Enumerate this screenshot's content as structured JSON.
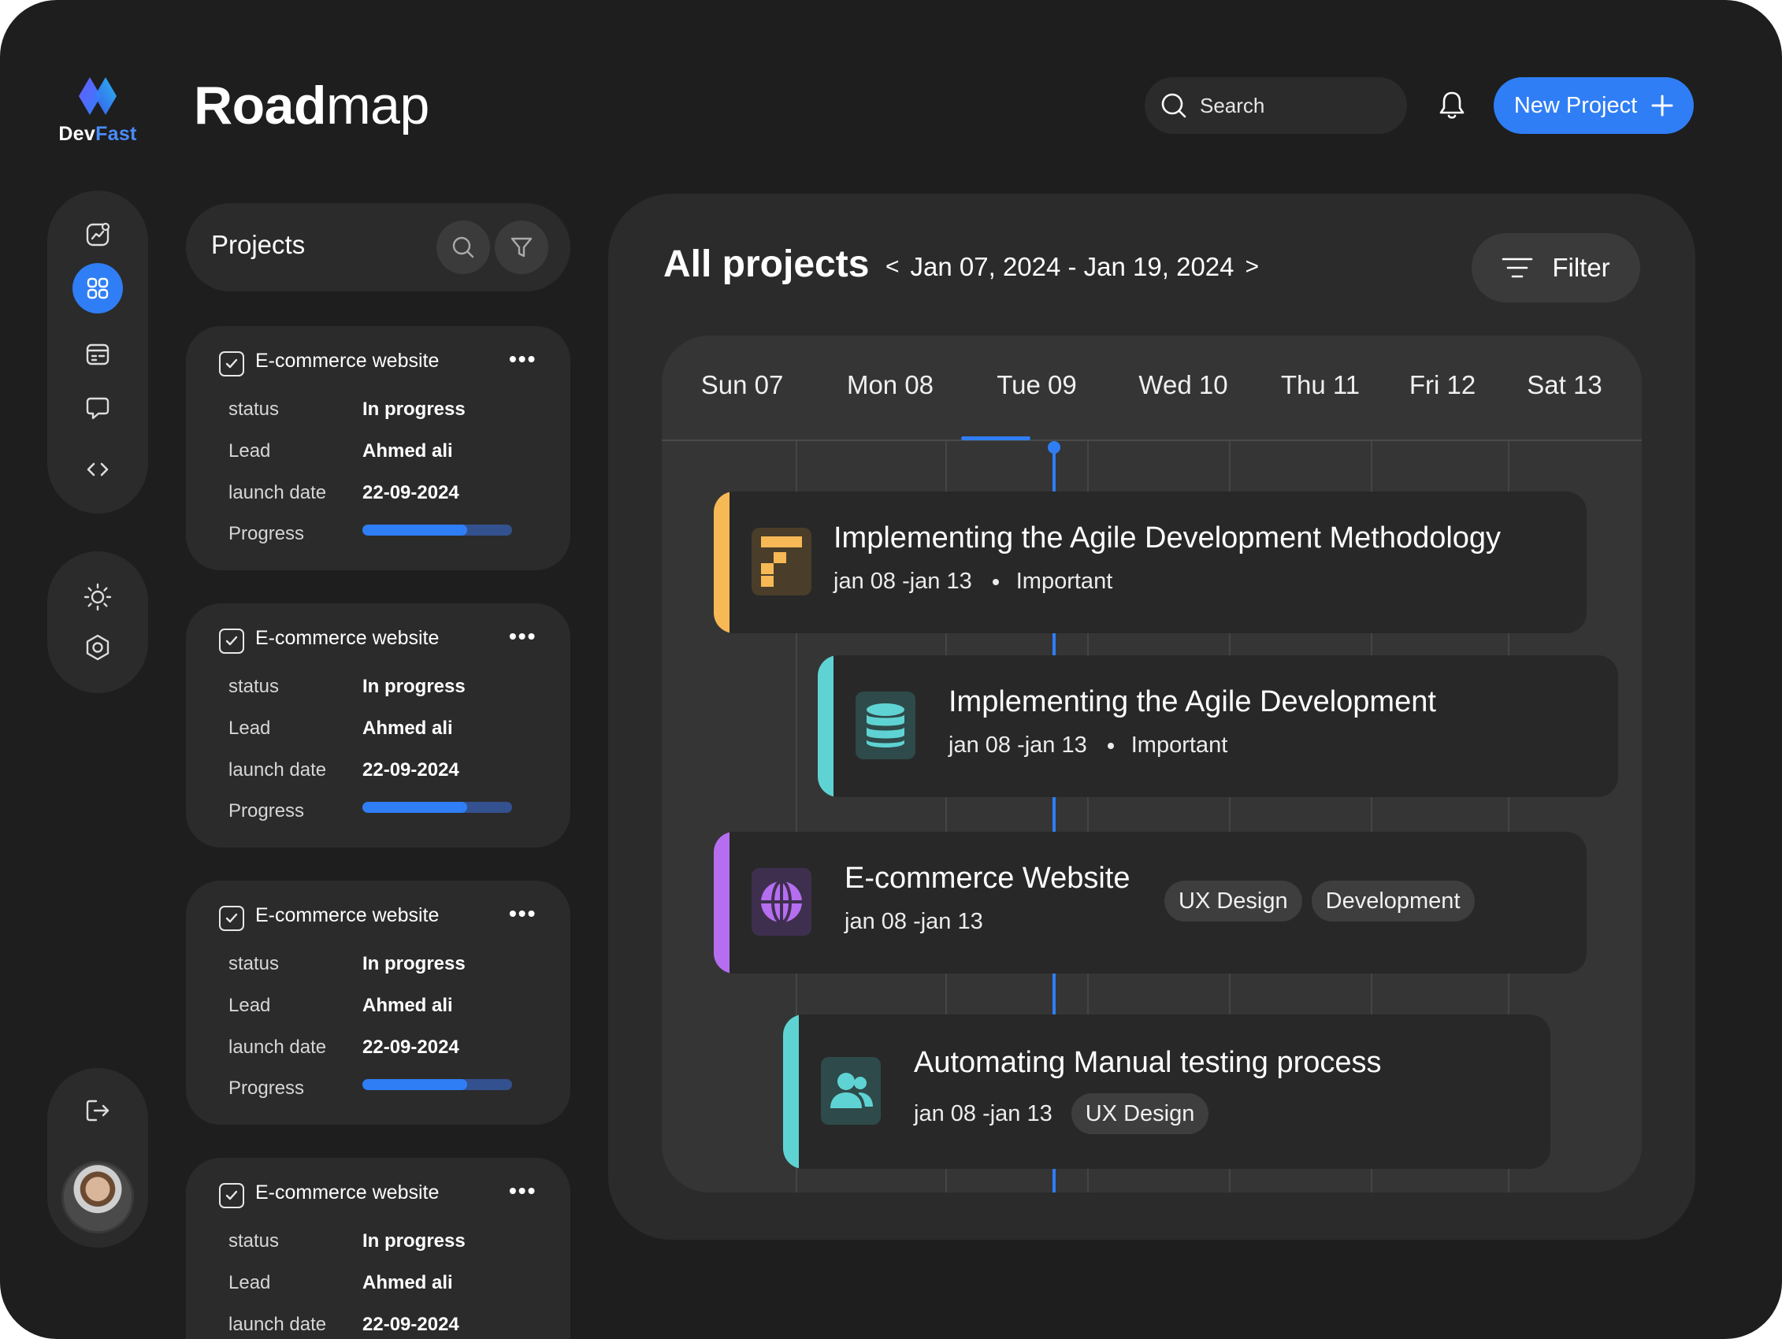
{
  "brand": {
    "name_a": "Dev",
    "name_b": "Fast",
    "accent": "#2f7ef5"
  },
  "page_title": {
    "bold": "Road",
    "regular": "map"
  },
  "header": {
    "search_placeholder": "Search",
    "new_project_label": "New Project"
  },
  "rail": {
    "items": [
      "analytics-icon",
      "grid-icon",
      "layout-icon",
      "chat-icon",
      "code-icon"
    ],
    "active": "grid-icon",
    "settings": [
      "sun-icon",
      "settings-icon"
    ],
    "bottom": [
      "logout-icon"
    ]
  },
  "projects": {
    "title": "Projects",
    "cards": [
      {
        "title": "E-commerce website",
        "status_label": "status",
        "status": "In progress",
        "lead_label": "Lead",
        "lead": "Ahmed ali",
        "date_label": "launch date",
        "date": "22-09-2024",
        "progress_label": "Progress",
        "progress": 0.7
      },
      {
        "title": "E-commerce website",
        "status_label": "status",
        "status": "In progress",
        "lead_label": "Lead",
        "lead": "Ahmed ali",
        "date_label": "launch date",
        "date": "22-09-2024",
        "progress_label": "Progress",
        "progress": 0.7
      },
      {
        "title": "E-commerce website",
        "status_label": "status",
        "status": "In progress",
        "lead_label": "Lead",
        "lead": "Ahmed ali",
        "date_label": "launch date",
        "date": "22-09-2024",
        "progress_label": "Progress",
        "progress": 0.7
      },
      {
        "title": "E-commerce website",
        "status_label": "status",
        "status": "In progress",
        "lead_label": "Lead",
        "lead": "Ahmed ali",
        "date_label": "launch date",
        "date": "22-09-2024"
      }
    ]
  },
  "main": {
    "title": "All projects",
    "range_prev": "<",
    "range": "Jan 07, 2024 - Jan 19, 2024",
    "range_next": ">",
    "filter_label": "Filter",
    "days": [
      "Sun 07",
      "Mon 08",
      "Tue 09",
      "Wed 10",
      "Thu 11",
      "Fri 12",
      "Sat 13"
    ],
    "selected_day": "Tue 09",
    "tasks": [
      {
        "title": "Implementing the Agile Development Methodology",
        "dates": "jan 08 -jan 13",
        "priority": "Important",
        "color": "#f7b955",
        "icon": "pixel-logo-icon"
      },
      {
        "title": "Implementing the Agile Development",
        "dates": "jan 08 -jan 13",
        "priority": "Important",
        "color": "#5fd3d3",
        "icon": "database-icon"
      },
      {
        "title": "E-commerce Website",
        "dates": "jan 08 -jan 13",
        "tags": [
          "UX Design",
          "Development"
        ],
        "color": "#b56ef0",
        "icon": "globe-icon"
      },
      {
        "title": "Automating Manual testing process",
        "dates": "jan 08 -jan 13",
        "tags": [
          "UX Design"
        ],
        "color": "#5fd3d3",
        "icon": "users-icon"
      }
    ]
  }
}
